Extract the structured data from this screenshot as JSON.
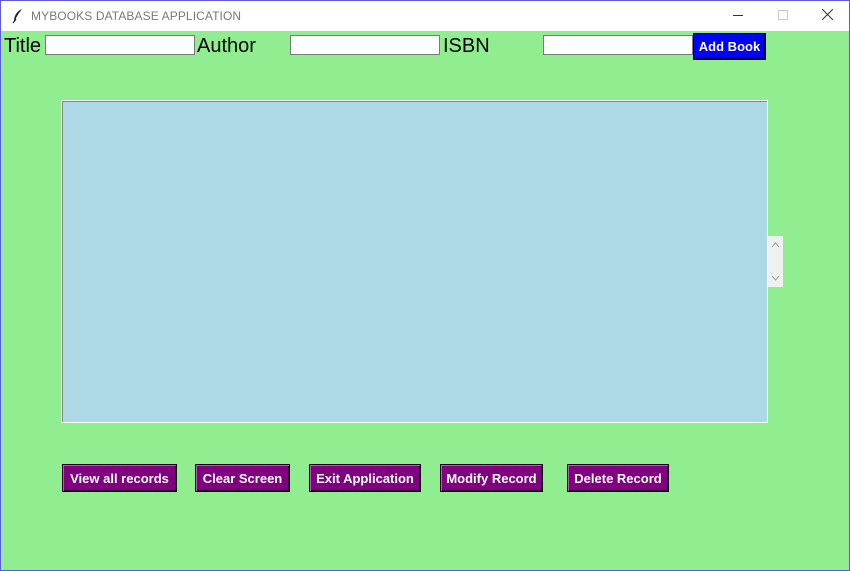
{
  "window": {
    "title": "MYBOOKS DATABASE APPLICATION",
    "controls": [
      "minimize",
      "maximize",
      "close"
    ]
  },
  "form": {
    "title_label": "Title",
    "title_value": "",
    "author_label": "Author",
    "author_value": "",
    "isbn_label": "ISBN",
    "isbn_value": "",
    "add_button": "Add Book"
  },
  "listbox": {
    "items": [],
    "background": "#add8e6"
  },
  "actions": {
    "view_all": "View all records",
    "clear": "Clear Screen",
    "exit": "Exit Application",
    "modify": "Modify Record",
    "delete": "Delete Record"
  },
  "colors": {
    "window_bg": "#90ee90",
    "add_button_bg": "#0000ff",
    "action_button_bg": "#800080"
  },
  "icons": {
    "app": "feather-icon",
    "minimize": "minimize-icon",
    "maximize": "maximize-icon",
    "close": "close-icon"
  }
}
